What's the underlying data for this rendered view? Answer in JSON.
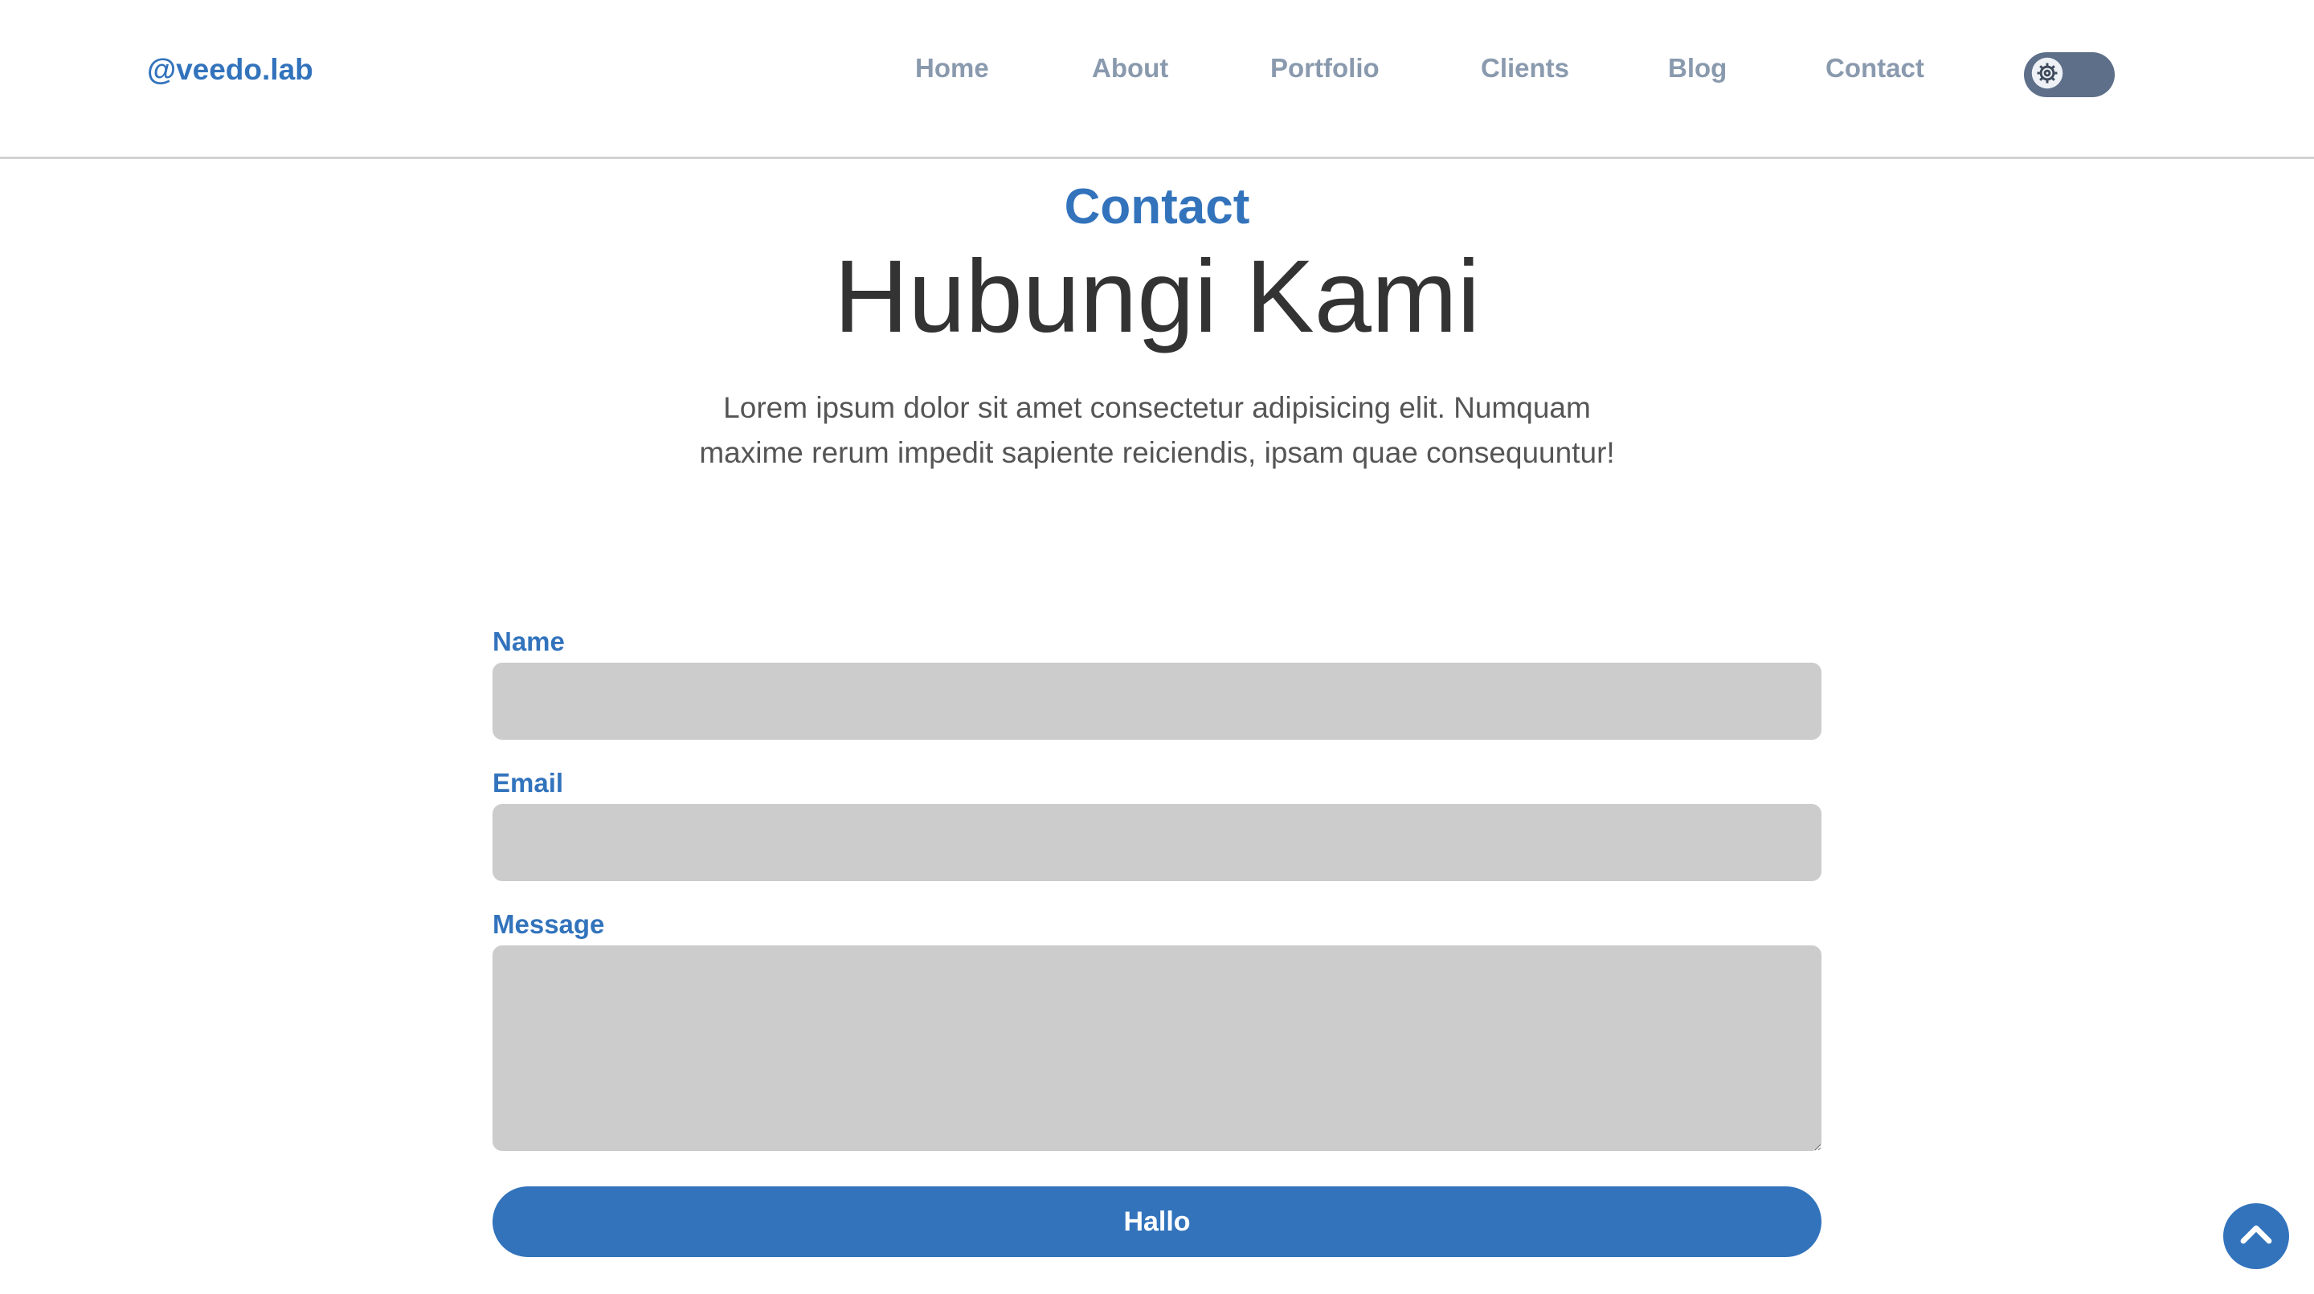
{
  "navbar": {
    "brand": "@veedo.lab",
    "links": [
      "Home",
      "About",
      "Portfolio",
      "Clients",
      "Blog",
      "Contact"
    ],
    "theme_toggle_icon": "gear-icon"
  },
  "header": {
    "tag": "Contact",
    "title": "Hubungi Kami",
    "description": "Lorem ipsum dolor sit amet consectetur adipisicing elit. Numquam maxime rerum impedit sapiente reiciendis, ipsam quae consequuntur!"
  },
  "form": {
    "name_label": "Name",
    "name_value": "",
    "email_label": "Email",
    "email_value": "",
    "message_label": "Message",
    "message_value": "",
    "submit_label": "Hallo"
  },
  "back_to_top_icon": "chevron-up-icon",
  "colors": {
    "primary": "#3273bc",
    "nav_link": "#8a9aae",
    "input_bg": "#cccccc",
    "toggle_bg": "#5e6f89"
  }
}
